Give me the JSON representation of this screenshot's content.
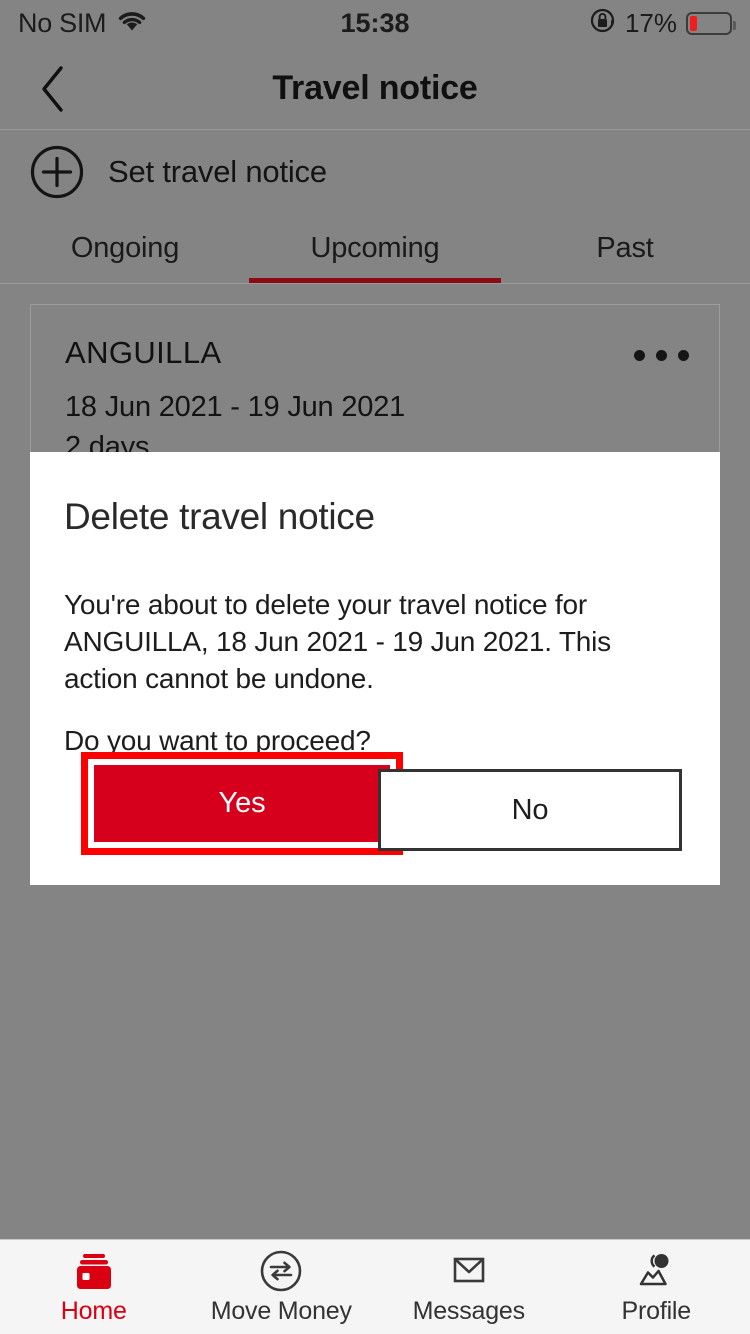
{
  "status_bar": {
    "carrier": "No SIM",
    "wifi_icon": "wifi-icon",
    "time": "15:38",
    "rotation_lock_icon": "rotation-lock-icon",
    "battery_percent": "17%",
    "battery_level": 17,
    "battery_low_color": "#f11c1c"
  },
  "header": {
    "back_icon": "chevron-left-icon",
    "title": "Travel notice"
  },
  "set_notice": {
    "icon": "plus-circle-icon",
    "label": "Set travel notice"
  },
  "tabs": {
    "items": [
      {
        "label": "Ongoing",
        "active": false
      },
      {
        "label": "Upcoming",
        "active": true
      },
      {
        "label": "Past",
        "active": false
      }
    ],
    "active_indicator_color": "#8c0a14"
  },
  "notice_card": {
    "country": "ANGUILLA",
    "dates": "18 Jun 2021 - 19 Jun 2021",
    "duration": "2 days",
    "menu_icon": "ellipsis-icon"
  },
  "dialog": {
    "title": "Delete travel notice",
    "body": "You're about to delete your travel notice for ANGUILLA, 18 Jun 2021 - 19 Jun 2021. This action cannot be undone.",
    "question": "Do you want to proceed?",
    "confirm_label": "Yes",
    "cancel_label": "No",
    "confirm_color": "#d6001c",
    "highlight_color": "#ff0000"
  },
  "bottom_nav": {
    "items": [
      {
        "label": "Home",
        "icon": "wallet-icon",
        "active": true
      },
      {
        "label": "Move Money",
        "icon": "transfer-arrows-icon",
        "active": false
      },
      {
        "label": "Messages",
        "icon": "envelope-icon",
        "active": false
      },
      {
        "label": "Profile",
        "icon": "people-icon",
        "active": false
      }
    ],
    "active_color": "#db0011"
  }
}
